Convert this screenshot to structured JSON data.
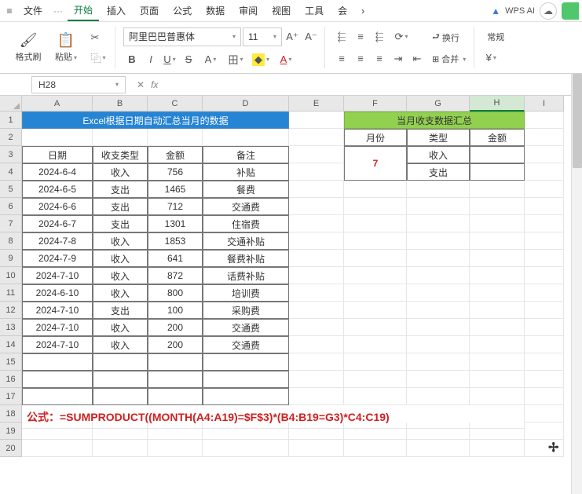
{
  "menu": {
    "hamburger": "≡",
    "file": "文件",
    "dots": "···",
    "tabs": [
      "开始",
      "插入",
      "页面",
      "公式",
      "数据",
      "审阅",
      "视图",
      "工具",
      "会"
    ],
    "more": "›",
    "ai": "WPS AI",
    "cloud": "☁"
  },
  "ribbon": {
    "format_brush": "格式刷",
    "paste": "粘贴",
    "font_name": "阿里巴巴普惠体",
    "font_size": "11",
    "wrap": "换行",
    "merge": "合并",
    "normal": "常规"
  },
  "fx": {
    "cell_ref": "H28",
    "fx_label": "fx",
    "formula": ""
  },
  "cols": [
    "A",
    "B",
    "C",
    "D",
    "E",
    "F",
    "G",
    "H",
    "I"
  ],
  "rows_count": 20,
  "blue_title": "Excel根据日期自动汇总当月的数据",
  "green_title": "当月收支数据汇总",
  "left_headers": {
    "date": "日期",
    "type": "收支类型",
    "amount": "金额",
    "note": "备注"
  },
  "right_headers": {
    "month": "月份",
    "type": "类型",
    "amount": "金额"
  },
  "left_rows": [
    {
      "d": "2024-6-4",
      "t": "收入",
      "a": "756",
      "n": "补贴"
    },
    {
      "d": "2024-6-5",
      "t": "支出",
      "a": "1465",
      "n": "餐费"
    },
    {
      "d": "2024-6-6",
      "t": "支出",
      "a": "712",
      "n": "交通费"
    },
    {
      "d": "2024-6-7",
      "t": "支出",
      "a": "1301",
      "n": "住宿费"
    },
    {
      "d": "2024-7-8",
      "t": "收入",
      "a": "1853",
      "n": "交通补贴"
    },
    {
      "d": "2024-7-9",
      "t": "收入",
      "a": "641",
      "n": "餐费补贴"
    },
    {
      "d": "2024-7-10",
      "t": "收入",
      "a": "872",
      "n": "话费补贴"
    },
    {
      "d": "2024-6-10",
      "t": "收入",
      "a": "800",
      "n": "培训费"
    },
    {
      "d": "2024-7-10",
      "t": "支出",
      "a": "100",
      "n": "采购费"
    },
    {
      "d": "2024-7-10",
      "t": "收入",
      "a": "200",
      "n": "交通费"
    },
    {
      "d": "2024-7-10",
      "t": "收入",
      "a": "200",
      "n": "交通费"
    }
  ],
  "right_month": "7",
  "right_types": [
    "收入",
    "支出"
  ],
  "formula_text": "公式：=SUMPRODUCT((MONTH(A4:A19)=$F$3)*(B4:B19=G3)*C4:C19)"
}
